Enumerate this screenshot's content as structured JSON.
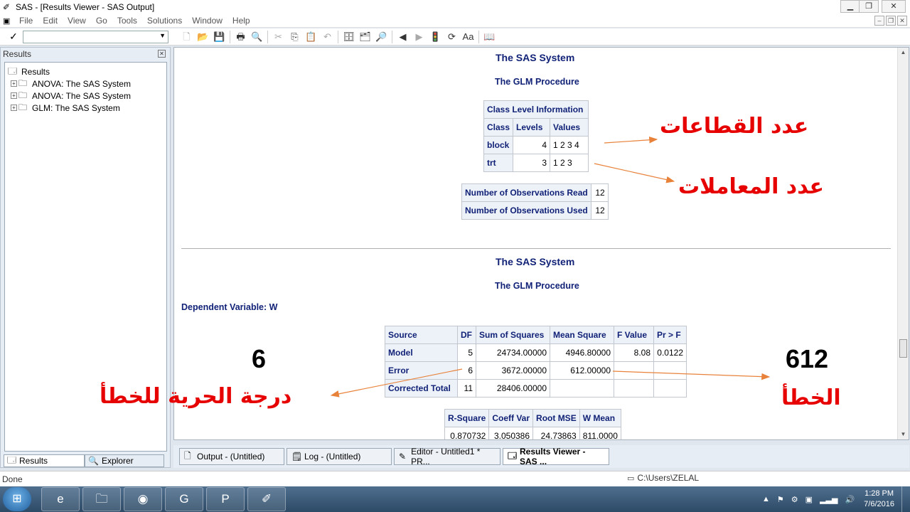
{
  "window": {
    "title": "SAS - [Results Viewer - SAS Output]",
    "controls": {
      "minimize": "▁",
      "restore": "❐",
      "close": "✕"
    },
    "mdi_controls": {
      "minimize": "–",
      "restore": "❐",
      "close": "✕"
    }
  },
  "menubar": {
    "items": [
      "File",
      "Edit",
      "View",
      "Go",
      "Tools",
      "Solutions",
      "Window",
      "Help"
    ]
  },
  "toolbar": {
    "command_value": "",
    "check": "✓",
    "icons": [
      {
        "name": "new-icon",
        "glyph": "🗋",
        "enabled": false
      },
      {
        "name": "open-icon",
        "glyph": "📂",
        "enabled": true
      },
      {
        "name": "save-icon",
        "glyph": "💾",
        "enabled": true
      },
      {
        "name": "print-icon",
        "glyph": "🖶",
        "enabled": true
      },
      {
        "name": "print-preview-icon",
        "glyph": "🔍",
        "enabled": false
      },
      {
        "name": "cut-icon",
        "glyph": "✂",
        "enabled": false
      },
      {
        "name": "copy-icon",
        "glyph": "⎘",
        "enabled": true
      },
      {
        "name": "paste-icon",
        "glyph": "📋",
        "enabled": false
      },
      {
        "name": "undo-icon",
        "glyph": "↶",
        "enabled": false
      },
      {
        "name": "libraries-icon",
        "glyph": "🗄",
        "enabled": true
      },
      {
        "name": "explorer-icon",
        "glyph": "🗂",
        "enabled": true
      },
      {
        "name": "find-icon",
        "glyph": "🔎",
        "enabled": true
      },
      {
        "name": "back-icon",
        "glyph": "◀",
        "enabled": true
      },
      {
        "name": "forward-icon",
        "glyph": "▶",
        "enabled": false
      },
      {
        "name": "stop-icon",
        "glyph": "🚦",
        "enabled": true
      },
      {
        "name": "refresh-icon",
        "glyph": "⟳",
        "enabled": true
      },
      {
        "name": "font-icon",
        "glyph": "Aa",
        "enabled": true
      },
      {
        "name": "help-icon",
        "glyph": "📖",
        "enabled": true
      }
    ]
  },
  "results_panel": {
    "title": "Results",
    "tree": {
      "root": "Results",
      "items": [
        "ANOVA:  The SAS System",
        "ANOVA:  The SAS System",
        "GLM:  The SAS System"
      ]
    },
    "tabs": [
      "Results",
      "Explorer"
    ]
  },
  "output": {
    "section1": {
      "title": "The SAS System",
      "procedure": "The GLM Procedure",
      "class_table": {
        "caption": "Class Level Information",
        "headers": [
          "Class",
          "Levels",
          "Values"
        ],
        "rows": [
          [
            "block",
            "4",
            "1 2 3 4"
          ],
          [
            "trt",
            "3",
            "1 2 3"
          ]
        ]
      },
      "obs_table": {
        "rows": [
          [
            "Number of Observations Read",
            "12"
          ],
          [
            "Number of Observations Used",
            "12"
          ]
        ]
      }
    },
    "section2": {
      "title": "The SAS System",
      "procedure": "The GLM Procedure",
      "dependent": "Dependent Variable: W",
      "anova_table": {
        "headers": [
          "Source",
          "DF",
          "Sum of Squares",
          "Mean Square",
          "F Value",
          "Pr > F"
        ],
        "rows": [
          [
            "Model",
            "5",
            "24734.00000",
            "4946.80000",
            "8.08",
            "0.0122"
          ],
          [
            "Error",
            "6",
            "3672.00000",
            "612.00000",
            "",
            ""
          ],
          [
            "Corrected Total",
            "11",
            "28406.00000",
            "",
            "",
            ""
          ]
        ]
      },
      "fit_table": {
        "headers": [
          "R-Square",
          "Coeff Var",
          "Root MSE",
          "W Mean"
        ],
        "row": [
          "0.870732",
          "3.050386",
          "24.73863",
          "811.0000"
        ]
      }
    }
  },
  "annotations": {
    "blocks_label": "عدد القطاعات",
    "treatments_label": "عدد المعاملات",
    "error_df_value": "6",
    "error_df_label": "درجة الحرية للخطأ",
    "error_value": "612",
    "error_label": "الخطأ",
    "arrow_color": "#e8823a"
  },
  "window_tabs": [
    {
      "label": "Output - (Untitled)",
      "icon": "output-icon",
      "active": false
    },
    {
      "label": "Log - (Untitled)",
      "icon": "log-icon",
      "active": false
    },
    {
      "label": "Editor - Untitled1 *   PR...",
      "icon": "editor-icon",
      "active": false
    },
    {
      "label": "Results Viewer - SAS ...",
      "icon": "results-viewer-icon",
      "active": true
    }
  ],
  "statusbar": {
    "left": "Done",
    "path": "C:\\Users\\ZELAL"
  },
  "taskbar": {
    "apps": [
      "internet-explorer-icon",
      "file-explorer-icon",
      "chrome-icon",
      "pdf-reader-icon",
      "powerpoint-icon",
      "sas-icon"
    ],
    "time": "1:28 PM",
    "date": "7/6/2016"
  }
}
